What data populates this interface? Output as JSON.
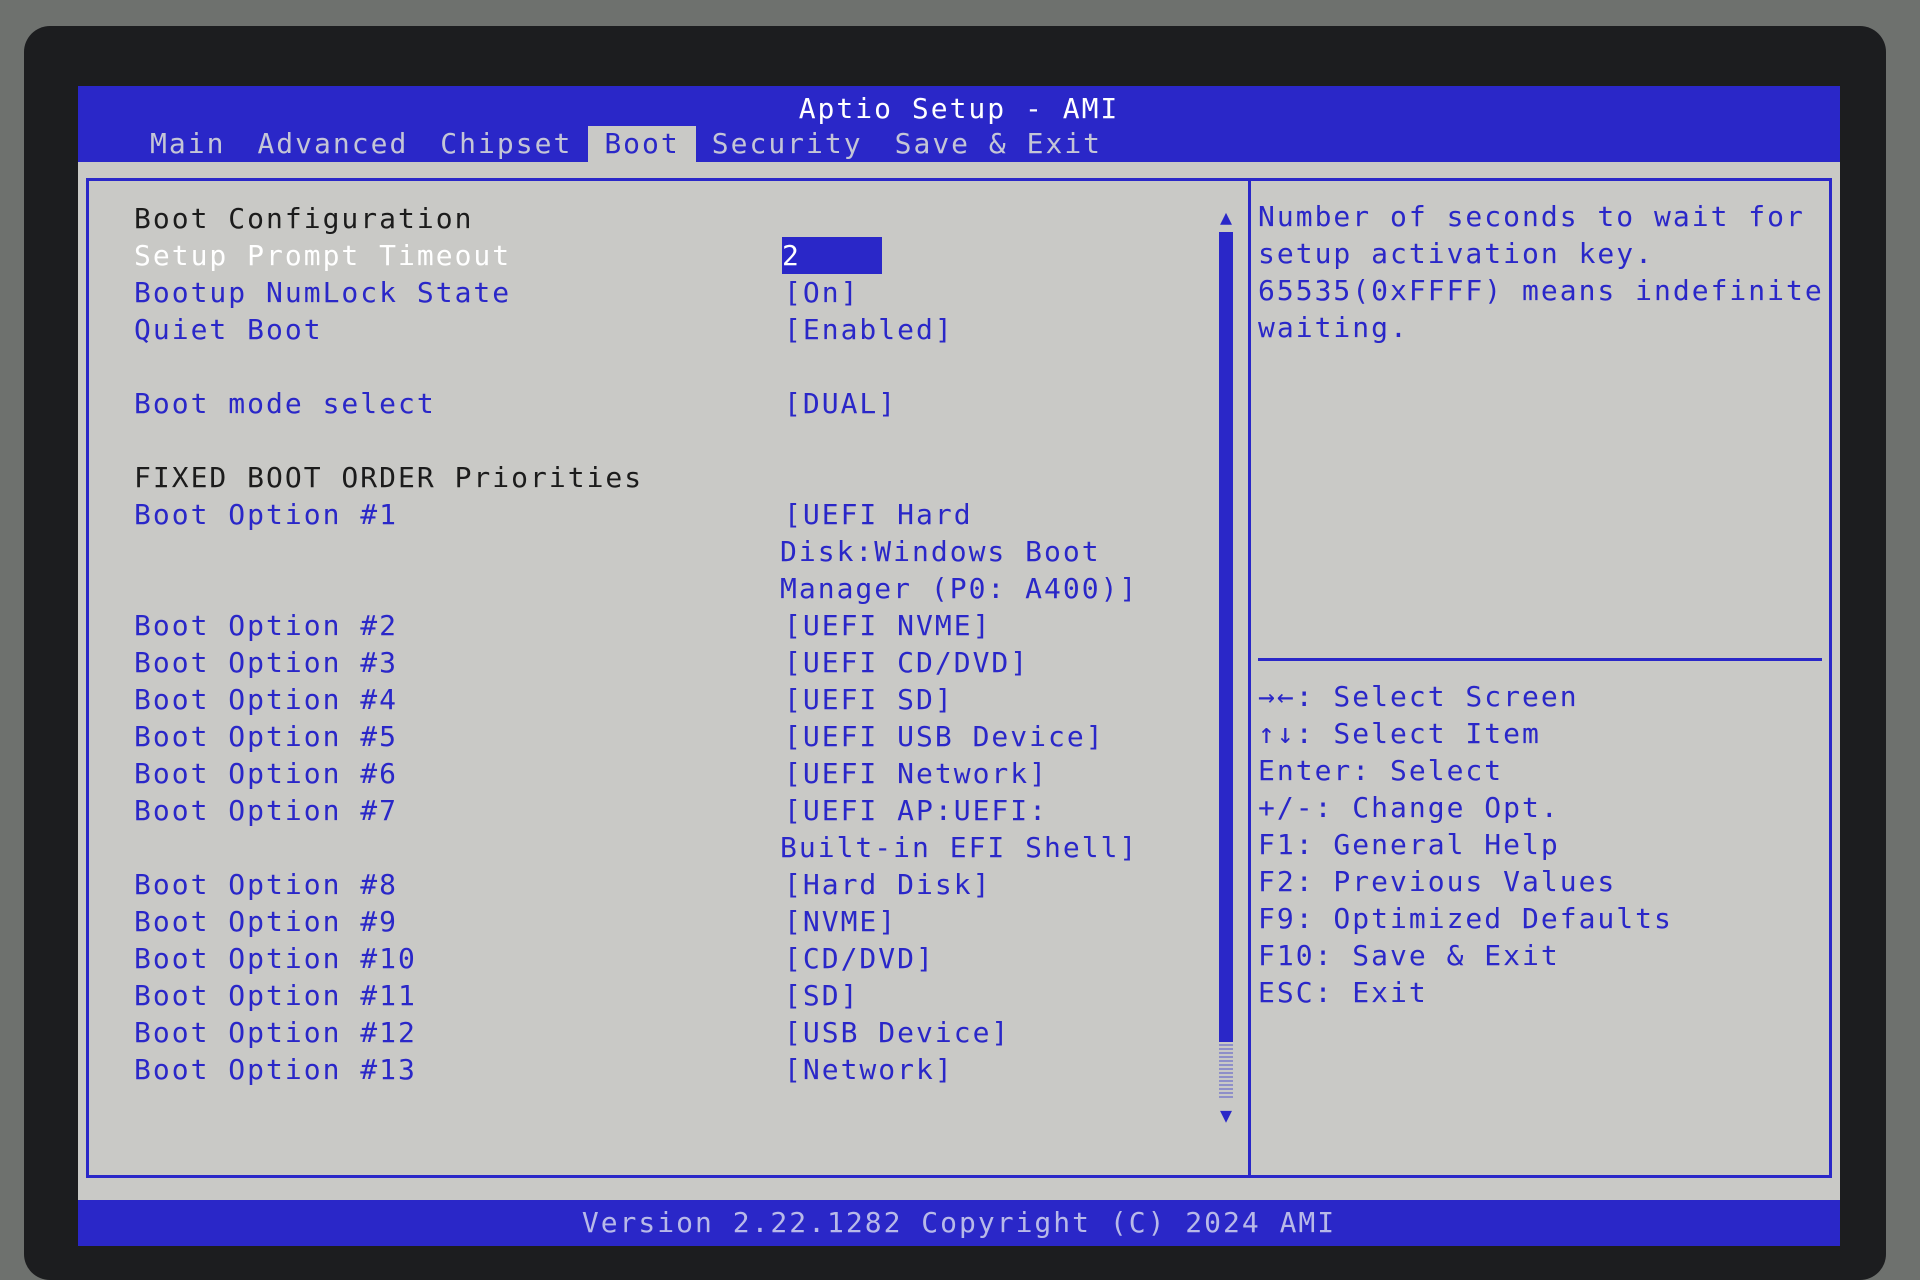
{
  "header": {
    "title": "Aptio Setup - AMI",
    "tabs": [
      "Main",
      "Advanced",
      "Chipset",
      "Boot",
      "Security",
      "Save & Exit"
    ],
    "active_tab": "Boot"
  },
  "boot": {
    "heading_config": "Boot Configuration",
    "setup_prompt_timeout": {
      "label": "Setup Prompt Timeout",
      "value": "2"
    },
    "numlock": {
      "label": "Bootup NumLock State",
      "value": "[On]"
    },
    "quiet_boot": {
      "label": "Quiet Boot",
      "value": "[Enabled]"
    },
    "boot_mode": {
      "label": "Boot mode select",
      "value": "[DUAL]"
    },
    "heading_order": "FIXED BOOT ORDER Priorities",
    "options": [
      {
        "label": "Boot Option #1",
        "value_lines": [
          "[UEFI Hard",
          "Disk:Windows Boot",
          "Manager (P0: A400)]"
        ]
      },
      {
        "label": "Boot Option #2",
        "value_lines": [
          "[UEFI NVME]"
        ]
      },
      {
        "label": "Boot Option #3",
        "value_lines": [
          "[UEFI CD/DVD]"
        ]
      },
      {
        "label": "Boot Option #4",
        "value_lines": [
          "[UEFI SD]"
        ]
      },
      {
        "label": "Boot Option #5",
        "value_lines": [
          "[UEFI USB Device]"
        ]
      },
      {
        "label": "Boot Option #6",
        "value_lines": [
          "[UEFI Network]"
        ]
      },
      {
        "label": "Boot Option #7",
        "value_lines": [
          "[UEFI AP:UEFI:",
          "Built-in EFI Shell]"
        ]
      },
      {
        "label": "Boot Option #8",
        "value_lines": [
          "[Hard Disk]"
        ]
      },
      {
        "label": "Boot Option #9",
        "value_lines": [
          "[NVME]"
        ]
      },
      {
        "label": "Boot Option #10",
        "value_lines": [
          "[CD/DVD]"
        ]
      },
      {
        "label": "Boot Option #11",
        "value_lines": [
          "[SD]"
        ]
      },
      {
        "label": "Boot Option #12",
        "value_lines": [
          "[USB Device]"
        ]
      },
      {
        "label": "Boot Option #13",
        "value_lines": [
          "[Network]"
        ]
      }
    ]
  },
  "help": {
    "lines": [
      "Number of seconds to wait for",
      "setup activation key.",
      "65535(0xFFFF) means indefinite",
      "waiting."
    ]
  },
  "keys": [
    "→←: Select Screen",
    "↑↓: Select Item",
    "Enter: Select",
    "+/-: Change Opt.",
    "F1: General Help",
    "F2: Previous Values",
    "F9: Optimized Defaults",
    "F10: Save & Exit",
    "ESC: Exit"
  ],
  "scrollbar": {
    "up_icon": "arrow-up-icon",
    "down_icon": "arrow-down-icon"
  },
  "footer": {
    "version": "Version 2.22.1282 Copyright (C) 2024 AMI"
  },
  "colors": {
    "accent": "#2a27c8",
    "background": "#c9c9c6",
    "selected_text": "#ffffff"
  }
}
